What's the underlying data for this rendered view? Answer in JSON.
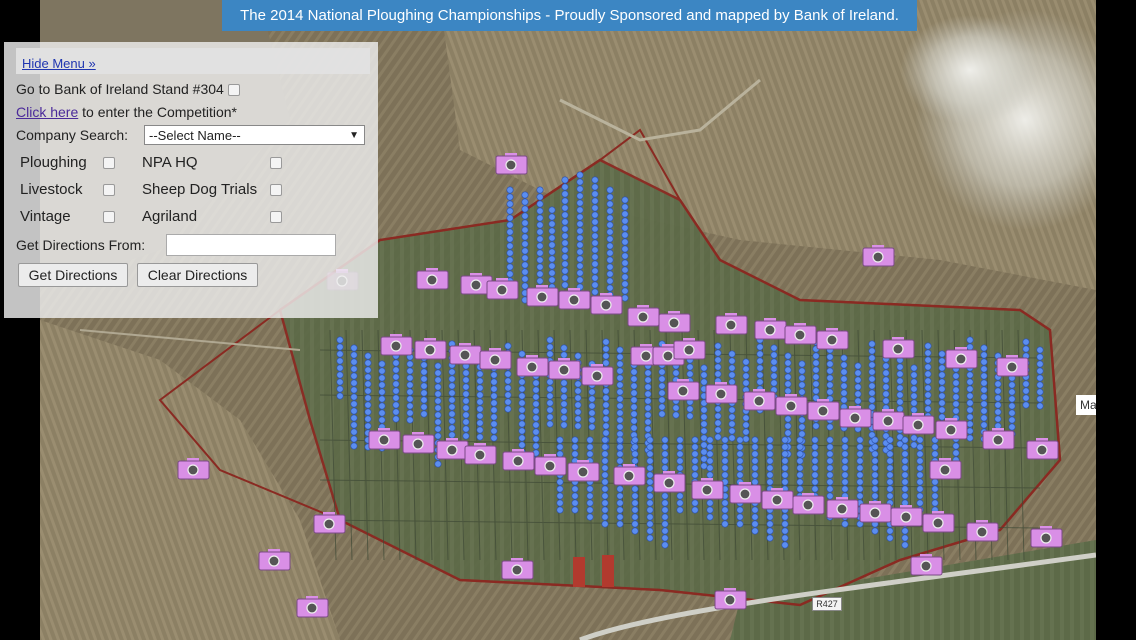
{
  "banner": {
    "text": "The 2014 National Ploughing Championships - Proudly Sponsored and mapped by Bank of Ireland."
  },
  "menu": {
    "hide_label": "Hide Menu »",
    "goto_label": "Go to Bank of Ireland Stand #304",
    "competition_link": "Click here",
    "competition_text": "to enter the Competition*",
    "company_search_label": "Company Search:",
    "company_search_value": "--Select Name--",
    "categories": {
      "ploughing": "Ploughing",
      "npa_hq": "NPA HQ",
      "livestock": "Livestock",
      "sheep_dog_trials": "Sheep Dog Trials",
      "vintage": "Vintage",
      "agriland": "Agriland"
    },
    "directions_label": "Get Directions From:",
    "directions_placeholder": "",
    "get_directions_button": "Get Directions",
    "clear_directions_button": "Clear Directions"
  },
  "map": {
    "edge_label": "Ma",
    "road_label": "R427",
    "marker_icon": "camera-icon",
    "pin_icon": "map-pin-icon",
    "colors": {
      "camera_marker": "#d98fe6",
      "pin": "#5b8ef0",
      "boundary": "#8a2a22"
    }
  }
}
